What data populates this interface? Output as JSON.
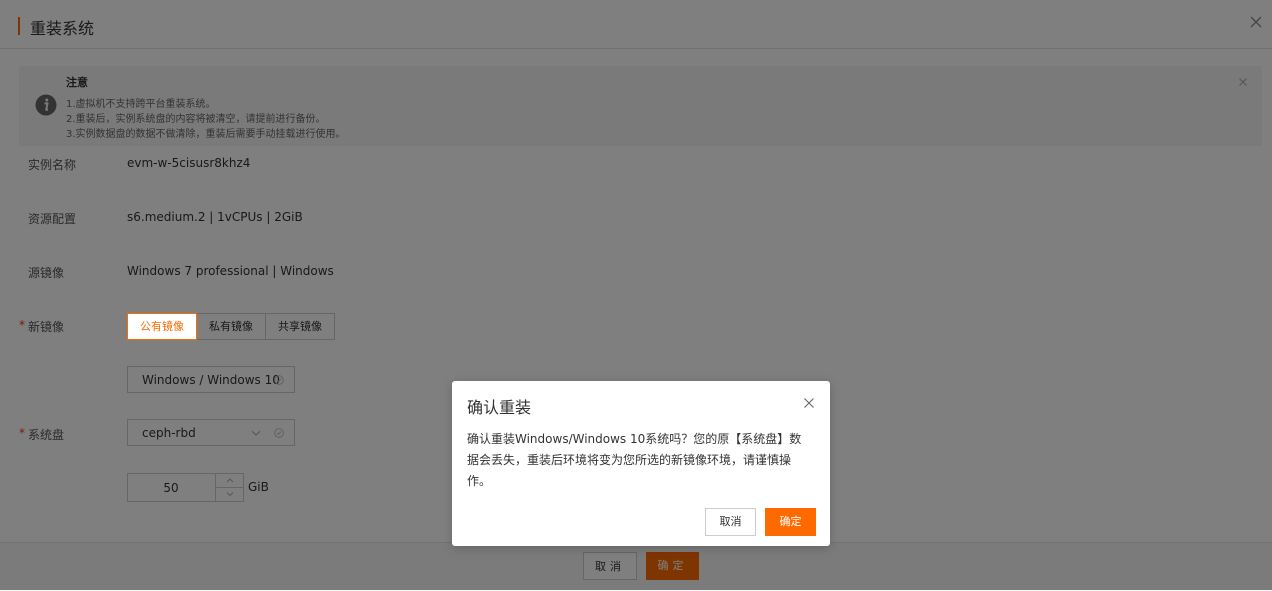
{
  "header": {
    "title": "重装系统"
  },
  "notice": {
    "title": "注意",
    "lines": [
      "1.虚拟机不支持跨平台重装系统。",
      "2.重装后，实例系统盘的内容将被清空，请提前进行备份。",
      "3.实例数据盘的数据不做清除，重装后需要手动挂载进行使用。"
    ]
  },
  "form": {
    "instance_name_label": "实例名称",
    "instance_name": "evm-w-5cisusr8khz4",
    "resource_label": "资源配置",
    "resource": "s6.medium.2 | 1vCPUs | 2GiB",
    "source_image_label": "源镜像",
    "source_image": "Windows 7 professional | Windows",
    "new_image_label": "新镜像",
    "required_mark": "*",
    "image_tabs": [
      "公有镜像",
      "私有镜像",
      "共享镜像"
    ],
    "selected_image": "Windows / Windows 10",
    "system_disk_label": "系统盘",
    "disk_type": "ceph-rbd",
    "disk_size": "50",
    "disk_unit": "GiB"
  },
  "footer": {
    "cancel": "取消",
    "ok": "确定"
  },
  "dialog": {
    "title": "确认重装",
    "body": "确认重装Windows/Windows 10系统吗？您的原【系统盘】数据会丢失，重装后环境将变为您所选的新镜像环境，请谨慎操作。",
    "cancel": "取消",
    "ok": "确定"
  },
  "colors": {
    "accent": "#ff6a00",
    "required": "#ff3300"
  }
}
